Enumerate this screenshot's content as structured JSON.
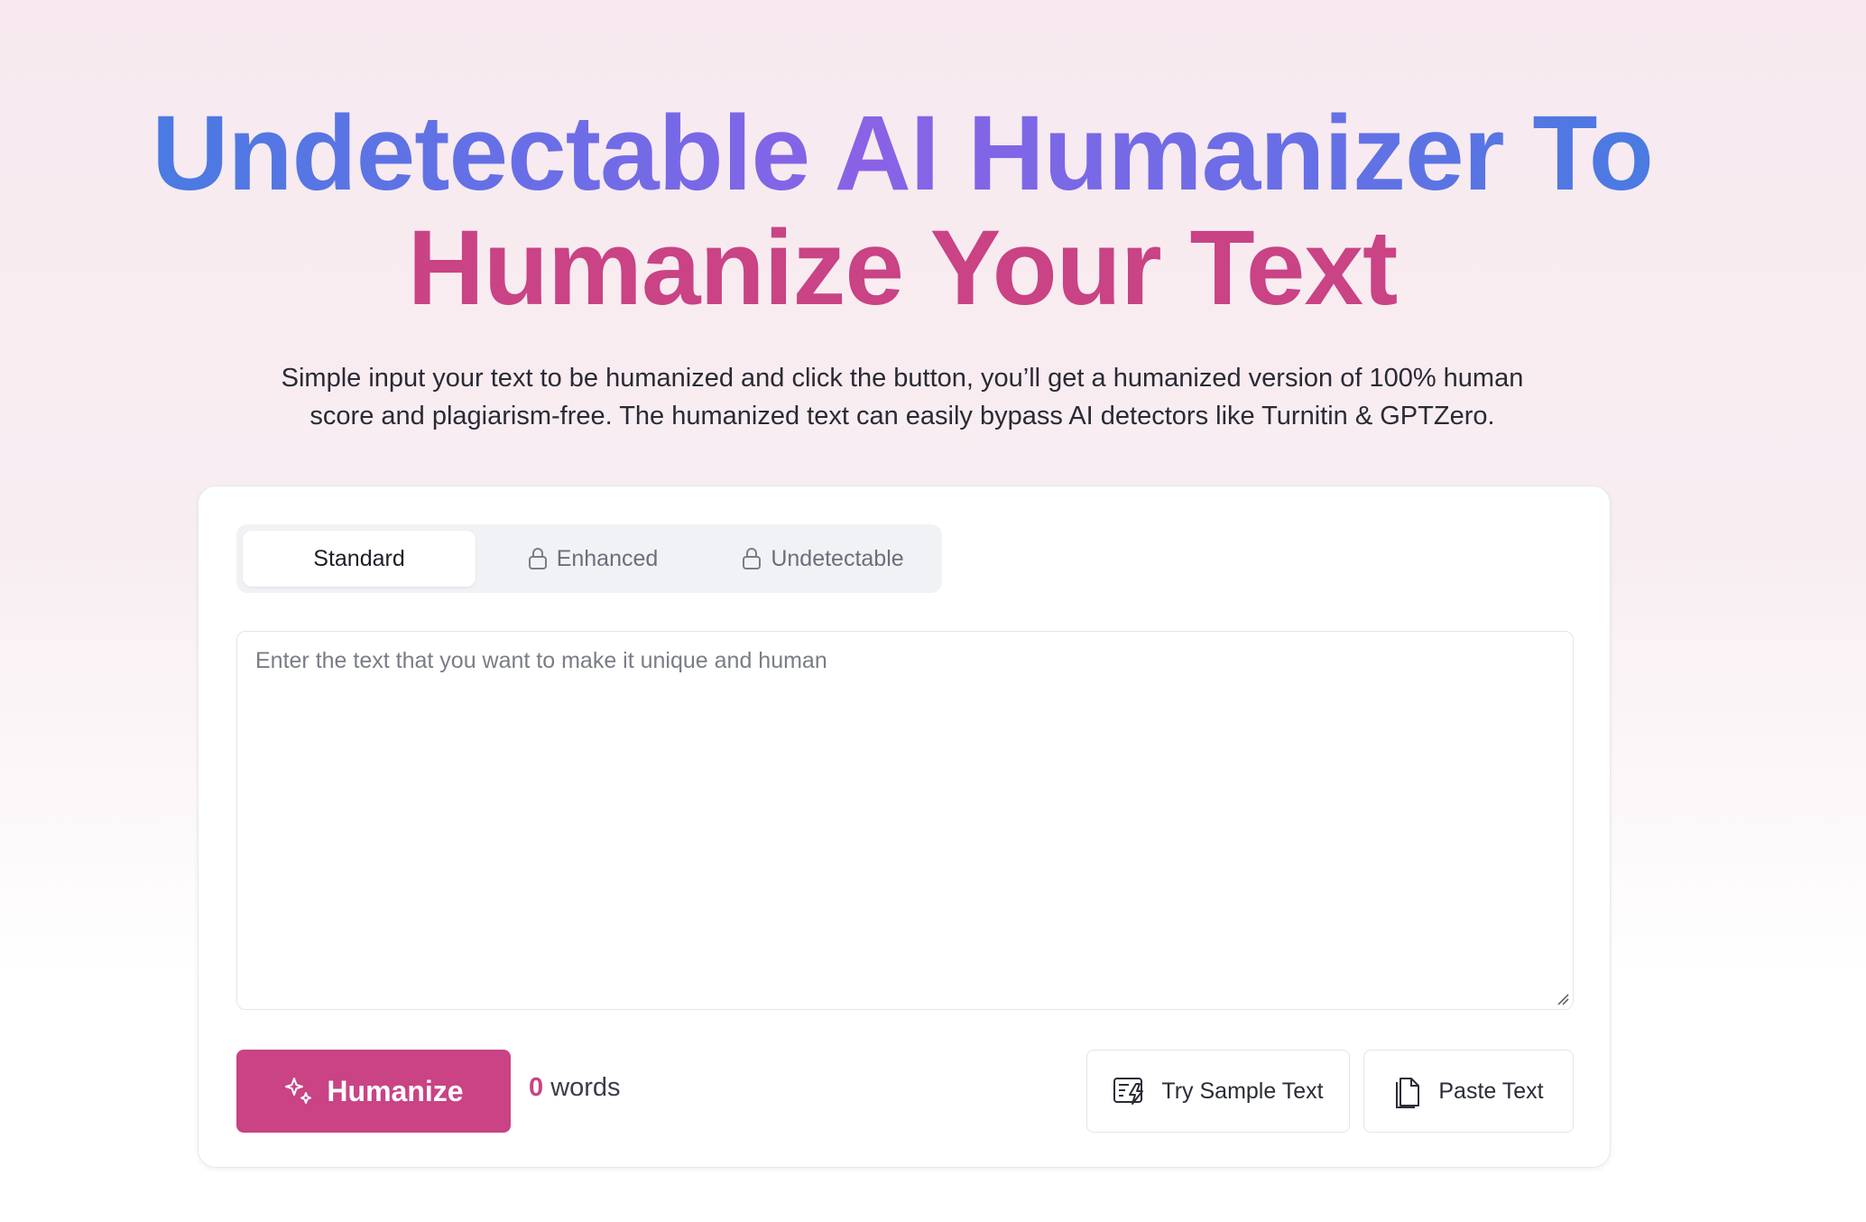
{
  "hero": {
    "title_line1": "Undetectable AI Humanizer To",
    "title_line2": "Humanize Your Text",
    "subtitle_line1": "Simple input your text to be humanized and click the button, you’ll get a humanized version of 100% human",
    "subtitle_line2": "score and plagiarism-free. The humanized text can easily bypass AI detectors like Turnitin & GPTZero."
  },
  "tabs": [
    {
      "label": "Standard",
      "active": true,
      "locked": false
    },
    {
      "label": "Enhanced",
      "active": false,
      "locked": true
    },
    {
      "label": "Undetectable",
      "active": false,
      "locked": true
    }
  ],
  "editor": {
    "placeholder": "Enter the text that you want to make it unique and human",
    "value": ""
  },
  "actions": {
    "humanize_label": "Humanize",
    "word_count": "0",
    "word_count_unit": " words",
    "sample_label": "Try Sample Text",
    "paste_label": "Paste Text"
  },
  "colors": {
    "accent": "#c94385",
    "title_blue": "#3d7fe0",
    "title_purple": "#8a62e6"
  },
  "icons": {
    "lock": "lock-icon",
    "sparkle": "sparkle-icon",
    "sample": "sample-text-icon",
    "paste": "paste-icon"
  }
}
